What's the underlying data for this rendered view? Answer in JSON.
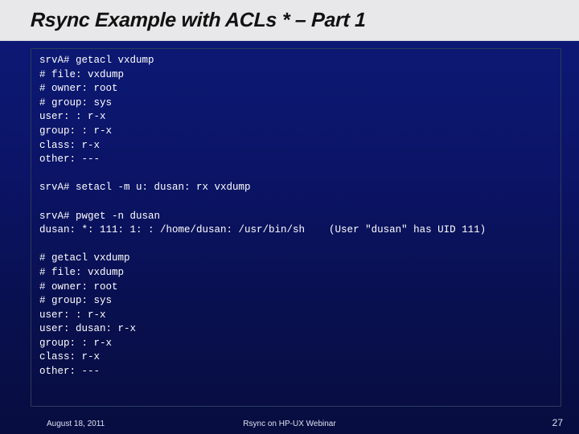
{
  "title": "Rsync Example with ACLs * – Part 1",
  "lines": {
    "l0": "srvA# getacl vxdump",
    "l1": "# file: vxdump",
    "l2": "# owner: root",
    "l3": "# group: sys",
    "l4": "user: : r-x",
    "l5": "group: : r-x",
    "l6": "class: r-x",
    "l7": "other: ---",
    "l8": "srvA# setacl -m u: dusan: rx vxdump",
    "l9": "srvA# pwget -n dusan",
    "l10": "dusan: *: 111: 1: : /home/dusan: /usr/bin/sh    (User \"dusan\" has UID 111)",
    "l11": "# getacl vxdump",
    "l12": "# file: vxdump",
    "l13": "# owner: root",
    "l14": "# group: sys",
    "l15": "user: : r-x",
    "l16": "user: dusan: r-x",
    "l17": "group: : r-x",
    "l18": "class: r-x",
    "l19": "other: ---"
  },
  "footer": {
    "date": "August 18, 2011",
    "center": "Rsync on HP-UX Webinar",
    "page": "27"
  }
}
